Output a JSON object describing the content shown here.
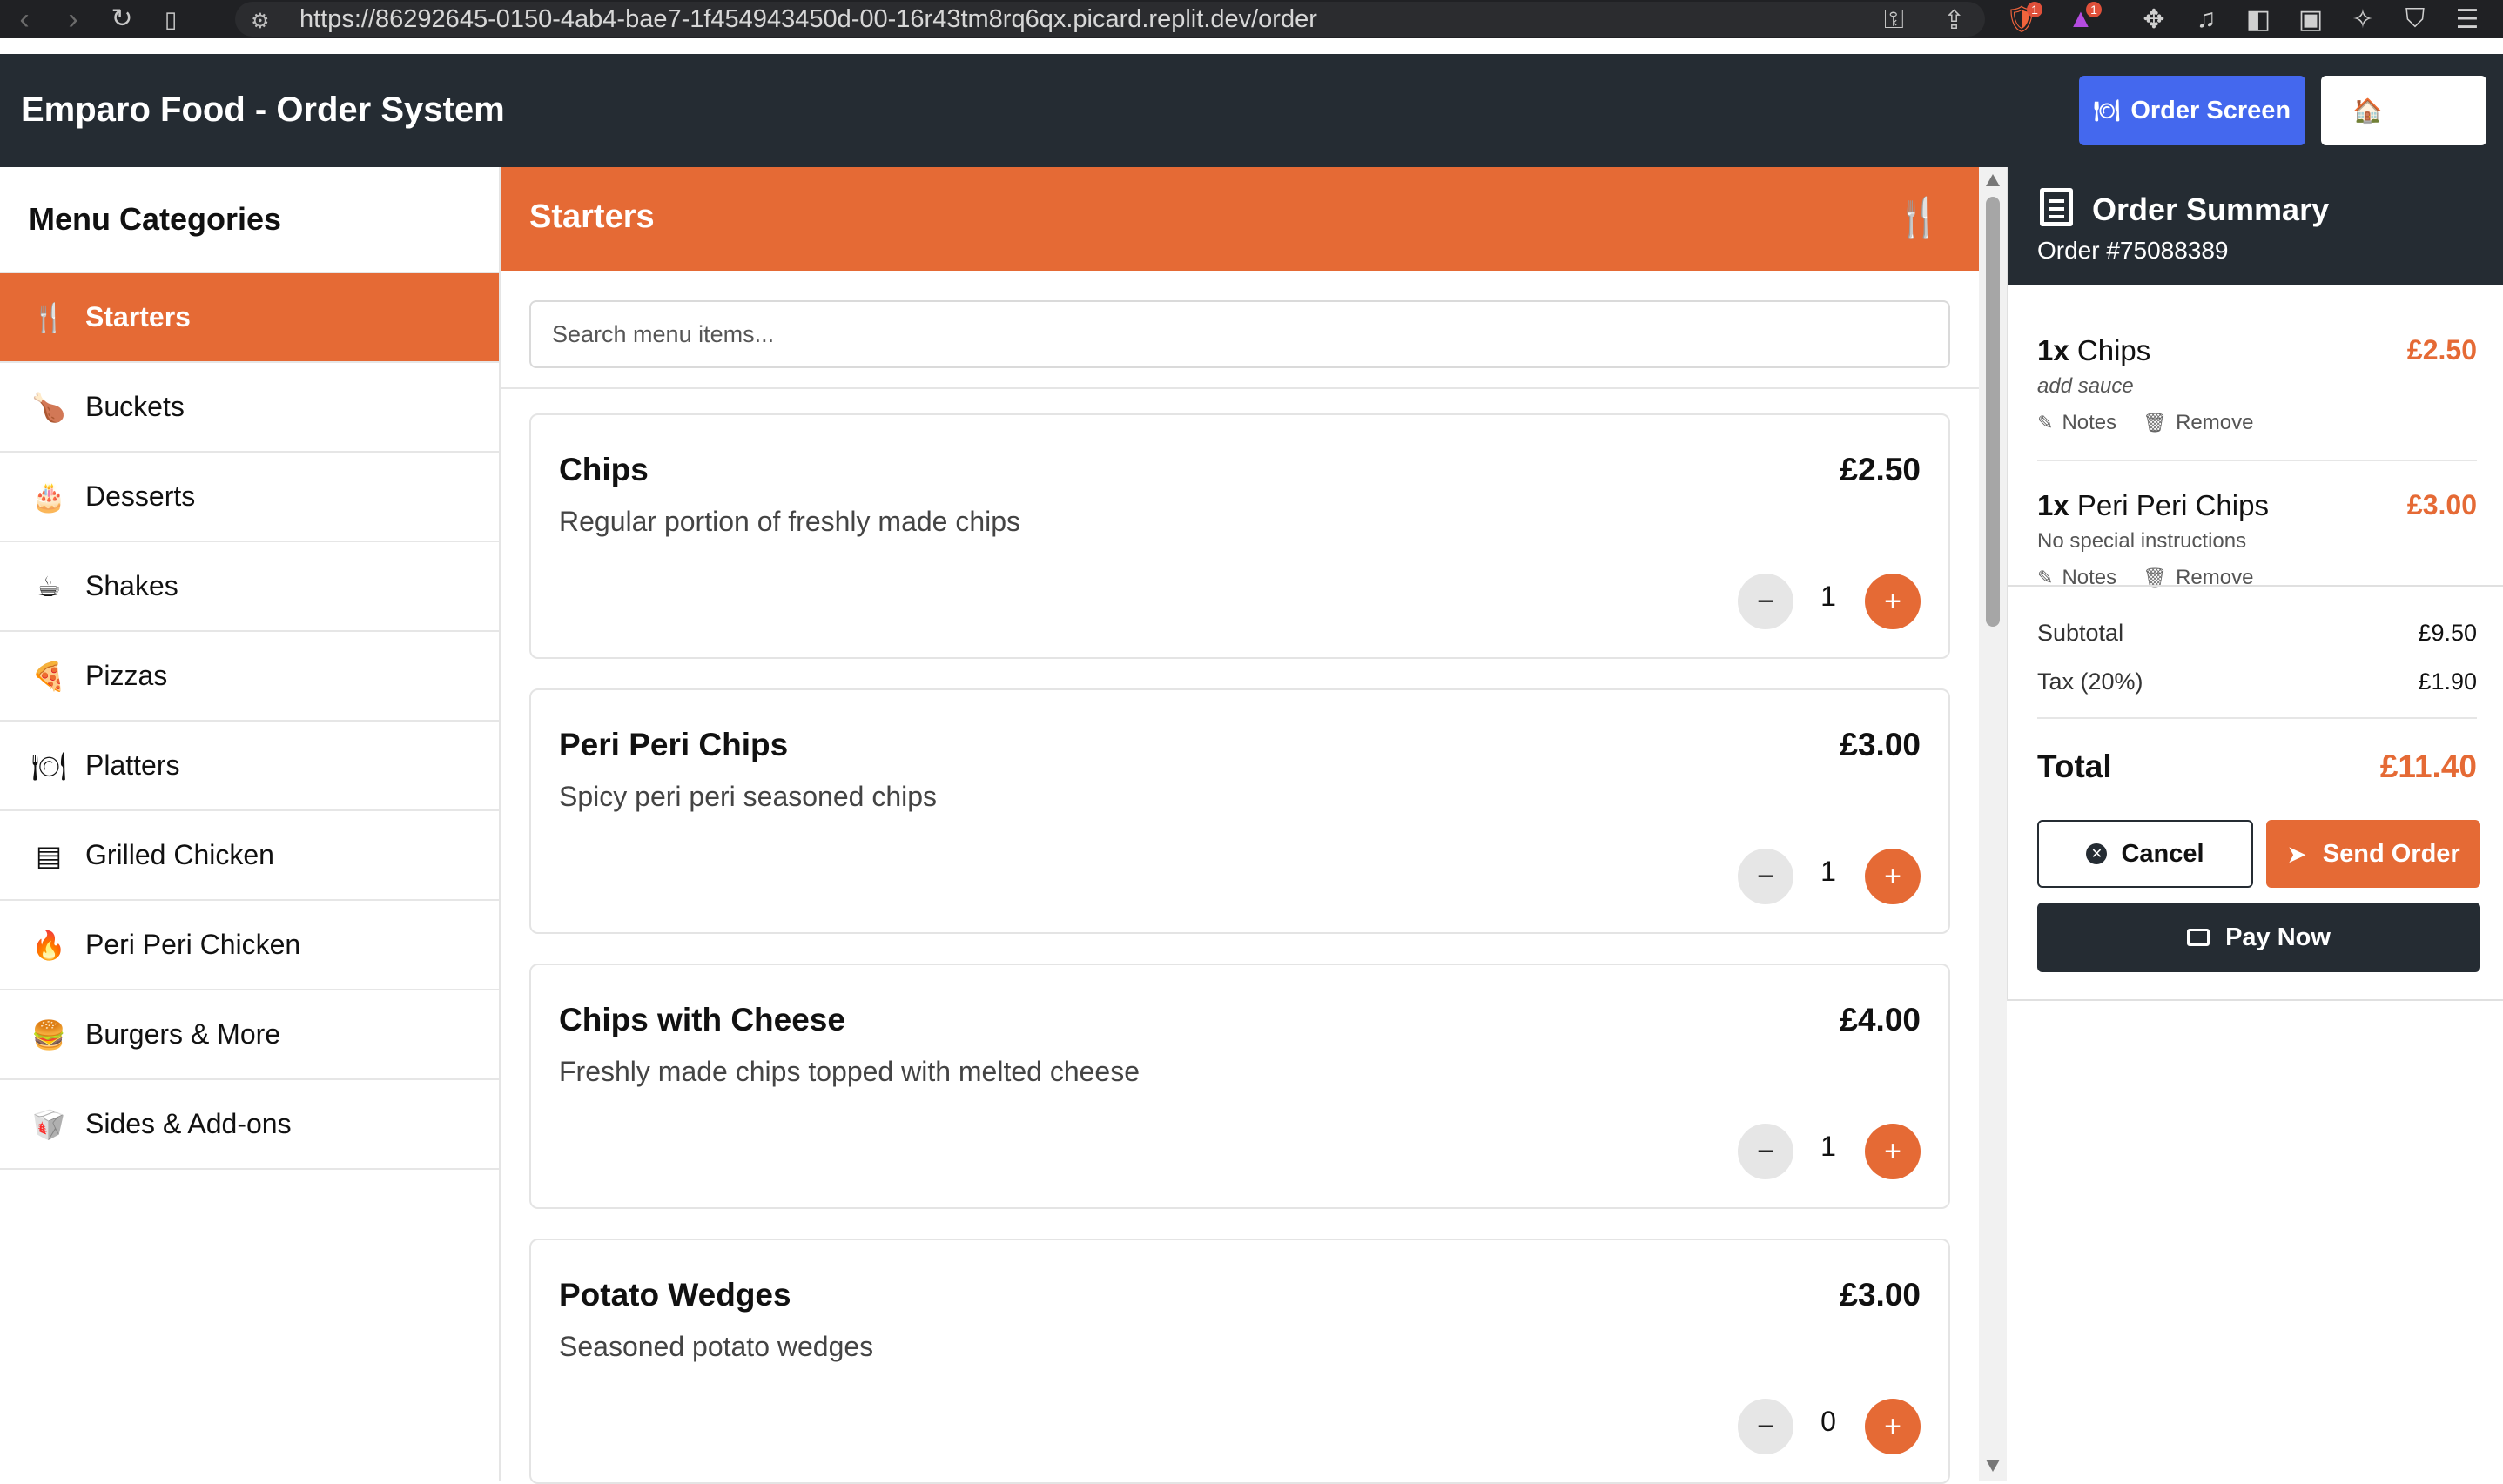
{
  "browser": {
    "url": "https://86292645-0150-4ab4-bae7-1f454943450d-00-16r43tm8rq6qx.picard.replit.dev/order",
    "badges": {
      "brave": "1",
      "rewards": "1"
    }
  },
  "header": {
    "title": "Emparo Food - Order System",
    "order_screen_label": "Order Screen",
    "home_icon": "🏠",
    "order_screen_icon": "🍽"
  },
  "sidebar": {
    "title": "Menu Categories",
    "items": [
      {
        "label": "Starters",
        "icon": "utensils-icon",
        "glyph": "🍴",
        "active": true
      },
      {
        "label": "Buckets",
        "icon": "drumstick-icon",
        "glyph": "🍗"
      },
      {
        "label": "Desserts",
        "icon": "cake-icon",
        "glyph": "🎂"
      },
      {
        "label": "Shakes",
        "icon": "mug-icon",
        "glyph": "☕"
      },
      {
        "label": "Pizzas",
        "icon": "pizza-icon",
        "glyph": "🍕"
      },
      {
        "label": "Platters",
        "icon": "platter-icon",
        "glyph": "🍽"
      },
      {
        "label": "Grilled Chicken",
        "icon": "grill-icon",
        "glyph": "▤"
      },
      {
        "label": "Peri Peri Chicken",
        "icon": "fire-icon",
        "glyph": "🔥"
      },
      {
        "label": "Burgers & More",
        "icon": "burger-icon",
        "glyph": "🍔"
      },
      {
        "label": "Sides & Add-ons",
        "icon": "side-dish-icon",
        "glyph": "🥡"
      }
    ]
  },
  "main": {
    "title": "Starters",
    "search": {
      "placeholder": "Search menu items...",
      "value": ""
    },
    "items": [
      {
        "name": "Chips",
        "price": "£2.50",
        "description": "Regular portion of freshly made chips",
        "qty": "1"
      },
      {
        "name": "Peri Peri Chips",
        "price": "£3.00",
        "description": "Spicy peri peri seasoned chips",
        "qty": "1"
      },
      {
        "name": "Chips with Cheese",
        "price": "£4.00",
        "description": "Freshly made chips topped with melted cheese",
        "qty": "1"
      },
      {
        "name": "Potato Wedges",
        "price": "£3.00",
        "description": "Seasoned potato wedges",
        "qty": "0"
      }
    ],
    "minus_label": "−",
    "plus_label": "+"
  },
  "summary": {
    "title": "Order Summary",
    "order_number": "Order #75088389",
    "lines": [
      {
        "qty": "1x",
        "name": "Chips",
        "price": "£2.50",
        "note": "add sauce"
      },
      {
        "qty": "1x",
        "name": "Peri Peri Chips",
        "price": "£3.00",
        "note": "No special instructions"
      }
    ],
    "notes_label": "Notes",
    "remove_label": "Remove",
    "subtotal_label": "Subtotal",
    "subtotal": "£9.50",
    "tax_label": "Tax (20%)",
    "tax": "£1.90",
    "total_label": "Total",
    "total": "£11.40",
    "cancel_label": "Cancel",
    "send_label": "Send Order",
    "pay_label": "Pay Now"
  },
  "colors": {
    "accent": "#e56a35",
    "dark": "#252c33",
    "blue": "#4468ee"
  }
}
